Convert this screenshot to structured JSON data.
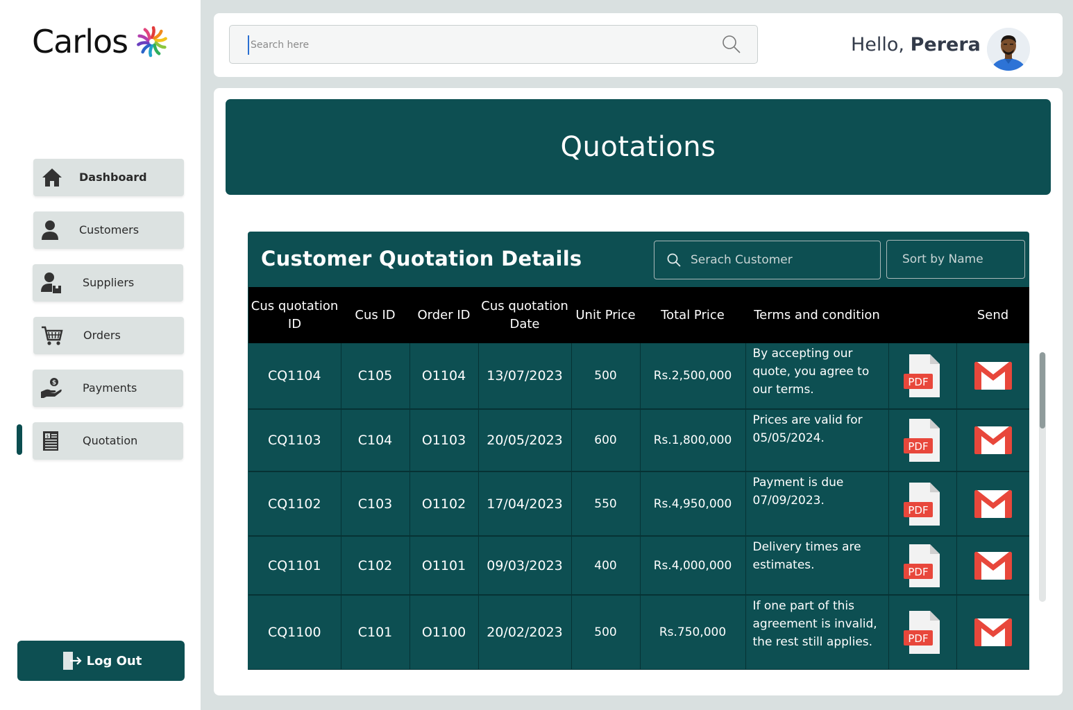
{
  "brand": {
    "name": "Carlos"
  },
  "sidebar": {
    "items": [
      {
        "label": "Dashboard",
        "icon": "home-icon"
      },
      {
        "label": "Customers",
        "icon": "user-icon"
      },
      {
        "label": "Suppliers",
        "icon": "supplier-icon"
      },
      {
        "label": "Orders",
        "icon": "cart-icon"
      },
      {
        "label": "Payments",
        "icon": "payment-icon"
      },
      {
        "label": "Quotation",
        "icon": "quotation-icon"
      }
    ],
    "active": "Quotation",
    "logout_label": "Log Out"
  },
  "header": {
    "search_placeholder": "Search here",
    "greeting_prefix": "Hello, ",
    "user_name": "Perera"
  },
  "main": {
    "banner_title": "Quotations",
    "panel_title": "Customer Quotation Details",
    "search_customer_placeholder": "Serach Customer",
    "sort_label": "Sort by Name",
    "columns": {
      "cqid": "Cus quotation ID",
      "cusid": "Cus ID",
      "orderid": "Order ID",
      "date": "Cus quotation Date",
      "unit": "Unit Price",
      "total": "Total Price",
      "terms": "Terms and condition",
      "send": "Send"
    },
    "rows": [
      {
        "cqid": "CQ1104",
        "cusid": "C105",
        "orderid": "O1104",
        "date": "13/07/2023",
        "unit": "500",
        "total": "Rs.2,500,000",
        "terms": "By accepting our quote, you agree to our terms."
      },
      {
        "cqid": "CQ1103",
        "cusid": "C104",
        "orderid": "O1103",
        "date": "20/05/2023",
        "unit": "600",
        "total": "Rs.1,800,000",
        "terms": "Prices are valid for 05/05/2024."
      },
      {
        "cqid": "CQ1102",
        "cusid": "C103",
        "orderid": "O1102",
        "date": "17/04/2023",
        "unit": "550",
        "total": "Rs.4,950,000",
        "terms": "Payment is due 07/09/2023."
      },
      {
        "cqid": "CQ1101",
        "cusid": "C102",
        "orderid": "O1101",
        "date": "09/03/2023",
        "unit": "400",
        "total": "Rs.4,000,000",
        "terms": "Delivery times are estimates."
      },
      {
        "cqid": "CQ1100",
        "cusid": "C101",
        "orderid": "O1100",
        "date": "20/02/2023",
        "unit": "500",
        "total": "Rs.750,000",
        "terms": "If one part of this agreement is invalid, the rest still applies."
      }
    ],
    "pdf_label": "PDF"
  },
  "colors": {
    "primary": "#0d4f52",
    "header_row": "#000000",
    "nav_bg": "#dce2e1",
    "page_bg": "#d9e0e0",
    "pdf_red": "#e8473b",
    "gmail_red": "#e8473b"
  }
}
